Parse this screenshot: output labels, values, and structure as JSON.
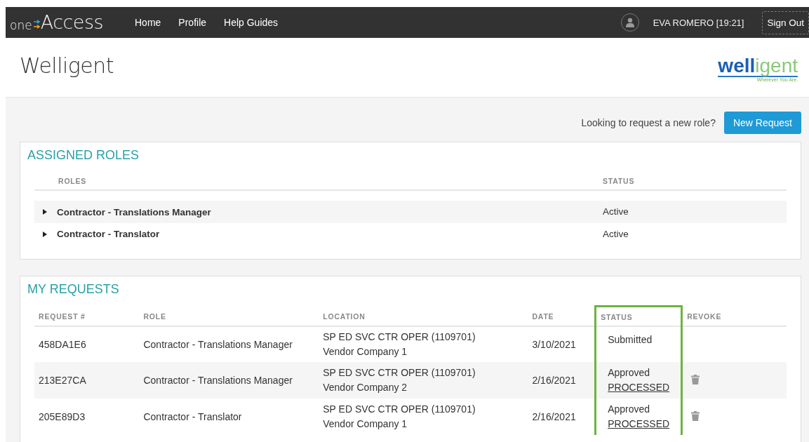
{
  "topbar": {
    "logo": {
      "prefix": "one",
      "main": "ccess",
      "letter": "A"
    },
    "nav": [
      {
        "label": "Home"
      },
      {
        "label": "Profile"
      },
      {
        "label": "Help Guides"
      }
    ],
    "user": "EVA ROMERO [19:21]",
    "sign_out": "Sign Out"
  },
  "header": {
    "title": "Welligent",
    "brand": {
      "bold": "well",
      "light": "igent",
      "tagline": "Wherever You Are."
    }
  },
  "request_prompt": "Looking to request a new role?",
  "new_request": "New Request",
  "assigned_roles": {
    "title": "ASSIGNED ROLES",
    "columns": [
      "ROLES",
      "STATUS"
    ],
    "rows": [
      {
        "role": "Contractor - Translations Manager",
        "status": "Active",
        "expanded": false
      },
      {
        "role": "Contractor - Translator",
        "status": "Active",
        "expanded": false
      }
    ]
  },
  "my_requests": {
    "title": "MY REQUESTS",
    "columns": [
      "REQUEST #",
      "ROLE",
      "LOCATION",
      "DATE",
      "STATUS",
      "REVOKE"
    ],
    "rows": [
      {
        "id": "458DA1E6",
        "role": "Contractor - Translations Manager",
        "location": [
          "SP ED SVC CTR OPER (1109701)",
          "Vendor Company 1"
        ],
        "date": "3/10/2021",
        "status": "Submitted",
        "revocable": false
      },
      {
        "id": "213E27CA",
        "role": "Contractor - Translations Manager",
        "location": [
          "SP ED SVC CTR OPER (1109701)",
          "Vendor Company 2"
        ],
        "date": "2/16/2021",
        "status": "Approved",
        "status_link": "PROCESSED",
        "revocable": true
      },
      {
        "id": "205E89D3",
        "role": "Contractor - Translator",
        "location": [
          "SP ED SVC CTR OPER (1109701)",
          "Vendor Company 1"
        ],
        "date": "2/16/2021",
        "status": "Approved",
        "status_link": "PROCESSED",
        "revocable": true
      }
    ]
  }
}
